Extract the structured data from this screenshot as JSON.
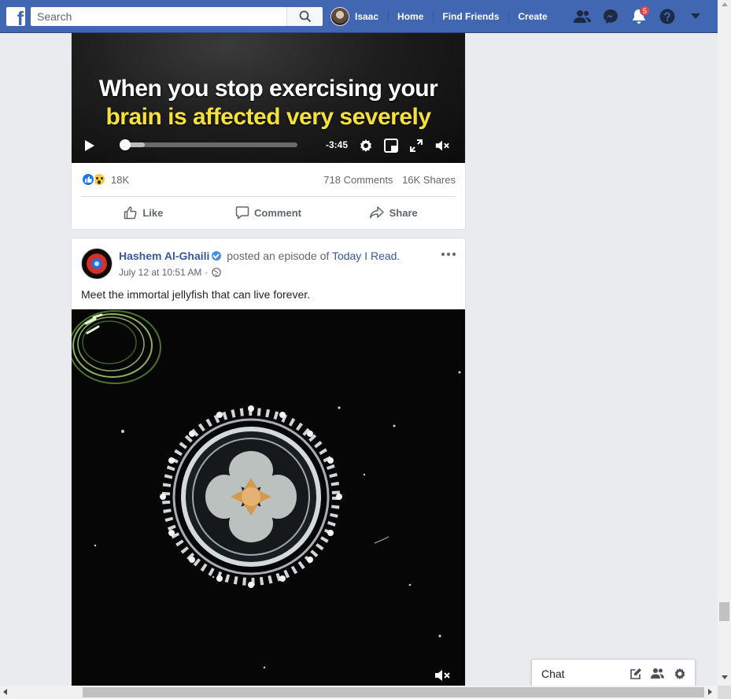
{
  "topbar": {
    "brand_color": "#4267b2",
    "search_placeholder": "Search",
    "profile_name": "Isaac",
    "nav_links": [
      "Home",
      "Find Friends",
      "Create"
    ],
    "icons": [
      "friend-requests-icon",
      "messenger-icon",
      "notifications-icon",
      "help-icon",
      "account-menu-caret-icon"
    ],
    "notifications_count": "5"
  },
  "post1": {
    "video": {
      "caption_line1": "When you stop exercising your",
      "caption_line2": "brain is affected very severely",
      "caption_line1_color": "#ffffff",
      "caption_line2_color": "#f5e13a",
      "time_remaining": "-3:45",
      "progress": 0.0
    },
    "reactions_count": "18K",
    "reaction_types": [
      "like",
      "wow"
    ],
    "comments": "718 Comments",
    "shares": "16K Shares",
    "actions": [
      "Like",
      "Comment",
      "Share"
    ]
  },
  "post2": {
    "author": "Hashem Al-Ghaili",
    "verb": " posted an episode of ",
    "show": "Today I Read.",
    "timestamp": "July 12 at 10:51 AM",
    "separator": "·",
    "privacy": "public-globe-icon",
    "text": "Meet the immortal jellyfish that can live forever."
  },
  "chat": {
    "label": "Chat"
  }
}
